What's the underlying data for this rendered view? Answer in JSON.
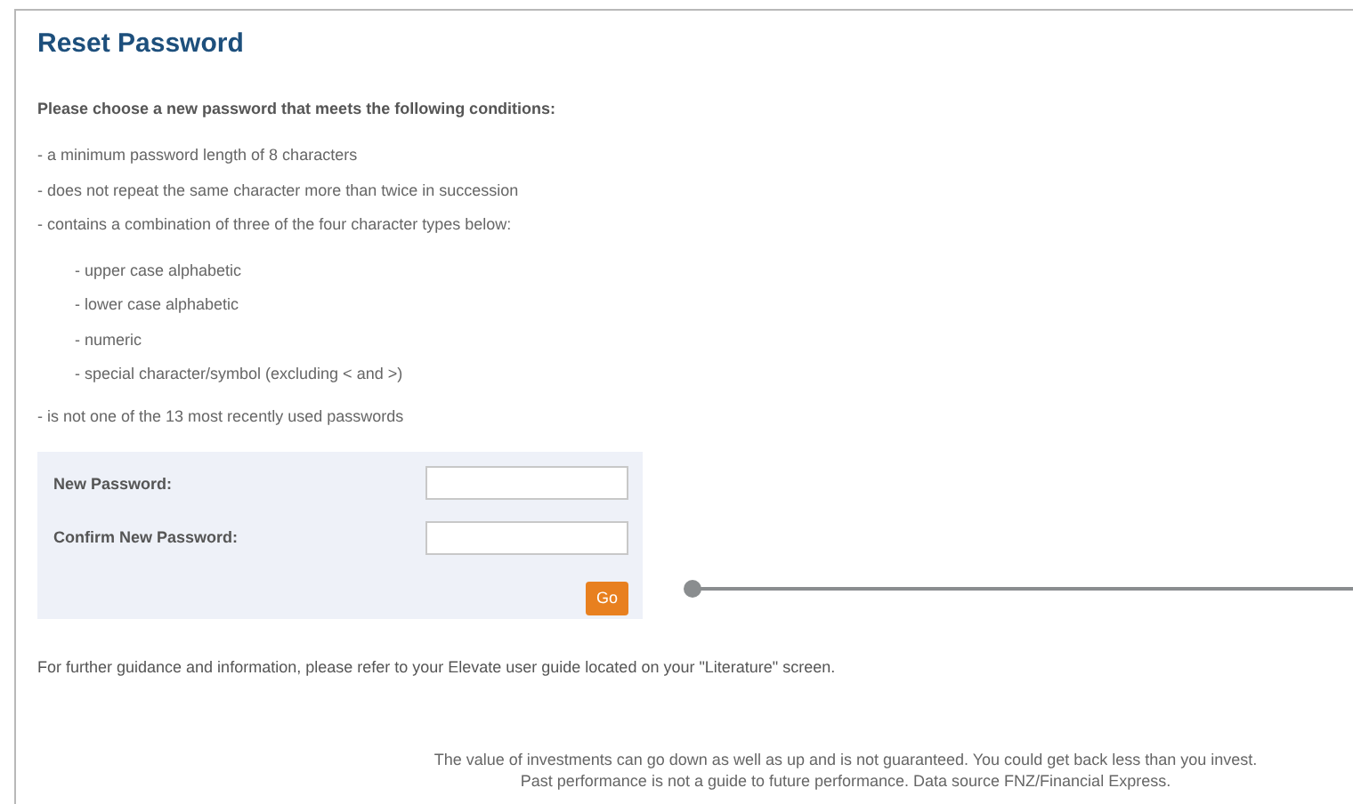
{
  "title": "Reset Password",
  "intro": "Please choose a new password that meets the following conditions:",
  "conditions": [
    {
      "text": "- a minimum password length of 8 characters"
    },
    {
      "text": "- does not repeat the same character more than twice in succession"
    },
    {
      "text": "- contains a combination of three of the four character types below:",
      "children": [
        {
          "text": "- upper case alphabetic"
        },
        {
          "text": "- lower case alphabetic"
        },
        {
          "text": "- numeric"
        },
        {
          "text": "- special character/symbol (excluding < and >)"
        }
      ]
    },
    {
      "text": "- is not one of the 13 most recently used passwords"
    }
  ],
  "form": {
    "fields": [
      {
        "label": "New Password:"
      },
      {
        "label": "Confirm New Password:"
      }
    ],
    "submit": "Go"
  },
  "guidance": "For further guidance and information, please refer to your Elevate user guide located on your \"Literature\" screen.",
  "disclaimer": [
    "The value of investments can go down as well as up and is not guaranteed. You could get back less than you invest.",
    "Past performance is not a guide to future performance. Data source FNZ/Financial Express."
  ]
}
